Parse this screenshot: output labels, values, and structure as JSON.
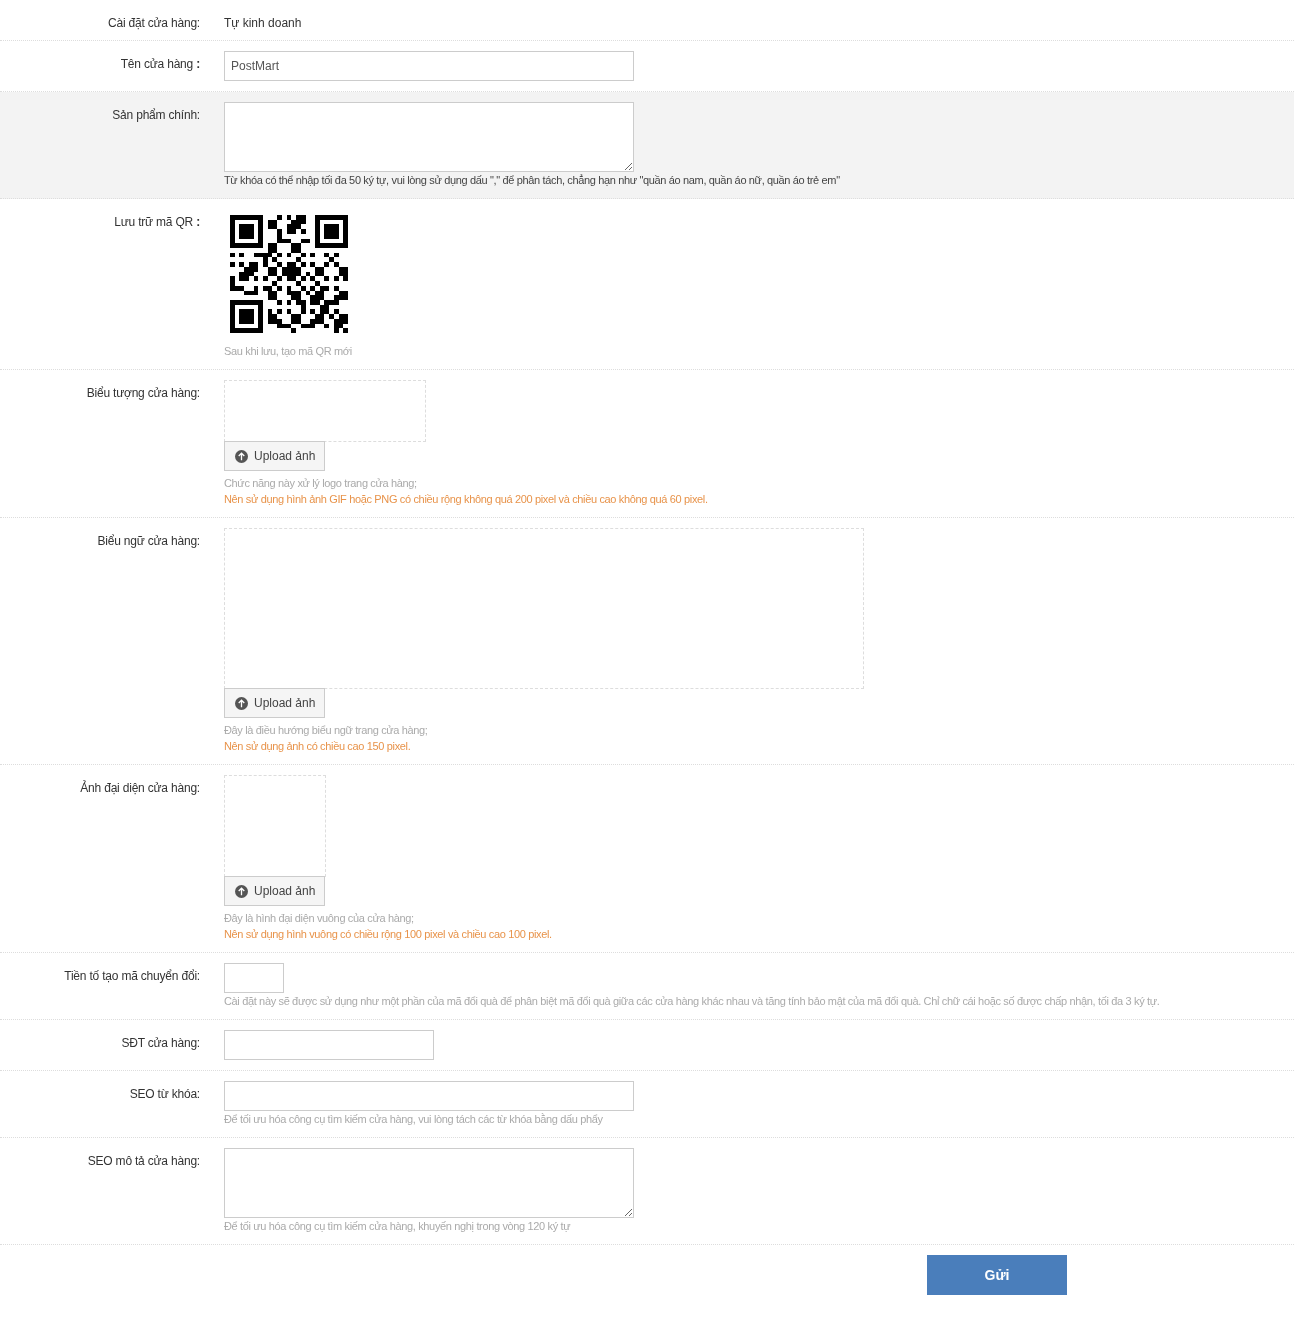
{
  "rows": [
    {
      "label": "Cài đặt cửa hàng:",
      "kind": "text",
      "highlighted": false,
      "value": "Tự kinh doanh",
      "hints": []
    },
    {
      "label": "Tên cửa hàng **:**",
      "kind": "input",
      "field": {
        "kind": "wide",
        "value": "PostMart"
      },
      "highlighted": false,
      "hints": []
    },
    {
      "label": "Sản phẩm chính:",
      "kind": "textarea",
      "highlighted": true,
      "hints": [
        {
          "text": "Từ khóa có thể nhập tối đa 50 ký tự, vui lòng sử dụng dấu \",\" để phân tách, chẳng hạn như \"quần áo nam, quần áo nữ, quần áo trẻ em\"",
          "kind": "dark"
        }
      ]
    },
    {
      "label": "Lưu trữ mã QR **:**",
      "kind": "qr",
      "highlighted": false,
      "hints": [
        {
          "text": "Sau khi lưu, tạo mã QR mới",
          "kind": "muted"
        }
      ]
    },
    {
      "label": "Biểu tượng cửa hàng:",
      "kind": "upload",
      "dropzone": {
        "kind": "logo"
      },
      "highlighted": false,
      "button": "Upload ảnh",
      "hints": [
        {
          "text": "Chức năng này xử lý logo trang cửa hàng;",
          "kind": "muted"
        },
        {
          "text": "Nên sử dụng hình ảnh GIF hoặc PNG có chiều rộng không quá 200 pixel và chiều cao không quá 60 pixel.",
          "kind": "accent"
        }
      ]
    },
    {
      "label": "Biểu ngữ cửa hàng:",
      "kind": "upload",
      "dropzone": {
        "kind": "banner"
      },
      "highlighted": false,
      "button": "Upload ảnh",
      "hints": [
        {
          "text": "Đây là điều hướng biểu ngữ trang cửa hàng;",
          "kind": "muted"
        },
        {
          "text": "Nên sử dụng ảnh có chiều cao 150 pixel.",
          "kind": "accent"
        }
      ]
    },
    {
      "label": "Ảnh đại diện cửa hàng:",
      "kind": "upload",
      "dropzone": {
        "kind": "square"
      },
      "highlighted": false,
      "button": "Upload ảnh",
      "hints": [
        {
          "text": "Đây là hình đại diện vuông của cửa hàng;",
          "kind": "muted"
        },
        {
          "text": "Nên sử dụng hình vuông có chiều rộng 100 pixel và chiều cao 100 pixel.",
          "kind": "accent"
        }
      ]
    },
    {
      "label": "Tiền tố tạo mã chuyển đổi:",
      "kind": "input",
      "field": {
        "kind": "small"
      },
      "highlighted": false,
      "hints": [
        {
          "text": "Cài đặt này sẽ được sử dụng như một phần của mã đổi quà để phân biệt mã đổi quà giữa các cửa hàng khác nhau và tăng tính bảo mật của mã đổi quà. Chỉ chữ cái hoặc số được chấp nhận, tối đa 3 ký tự.",
          "kind": "muted"
        }
      ]
    },
    {
      "label": "SĐT cửa hàng:",
      "kind": "input",
      "field": {
        "kind": "medium"
      },
      "highlighted": false,
      "hints": []
    },
    {
      "label": "SEO từ khóa:",
      "kind": "input",
      "field": {
        "kind": "wide"
      },
      "highlighted": false,
      "hints": [
        {
          "text": "Để tối ưu hóa công cụ tìm kiếm cửa hàng, vui lòng tách các từ khóa bằng dấu phẩy",
          "kind": "muted"
        }
      ]
    },
    {
      "label": "SEO mô tả cửa hàng:",
      "kind": "textarea",
      "highlighted": false,
      "hints": [
        {
          "text": "Để tối ưu hóa công cụ tìm kiếm cửa hàng, khuyến nghị trong vòng 120 ký tự",
          "kind": "muted"
        }
      ]
    }
  ],
  "submit": "Gửi"
}
